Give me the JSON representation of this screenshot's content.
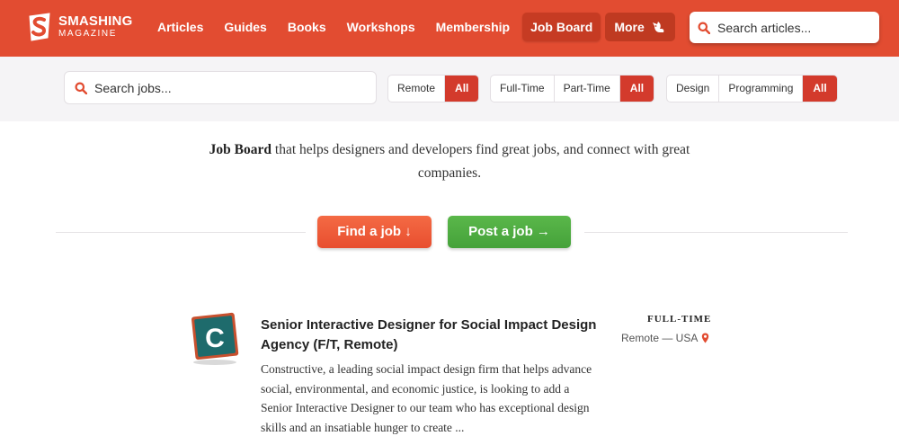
{
  "header": {
    "logo_line1": "SMASHING",
    "logo_line2": "MAGAZINE",
    "nav": [
      "Articles",
      "Guides",
      "Books",
      "Workshops",
      "Membership",
      "Job Board"
    ],
    "more_label": "More",
    "search_placeholder": "Search articles..."
  },
  "filters": {
    "search_placeholder": "Search jobs...",
    "location": [
      "Remote",
      "All"
    ],
    "employment": [
      "Full-Time",
      "Part-Time",
      "All"
    ],
    "category": [
      "Design",
      "Programming",
      "All"
    ]
  },
  "intro": {
    "bold": "Job Board",
    "text": " that helps designers and developers find great jobs, and connect with great companies."
  },
  "actions": {
    "find": "Find a job ↓",
    "post": "Post a job →"
  },
  "job": {
    "logo_letter": "C",
    "title": "Senior Interactive Designer for Social Impact Design Agency (F/T, Remote)",
    "description": "Constructive, a leading social impact design firm that helps advance social, environmental, and economic justice, is looking to add a Senior Interactive Designer to our team who has exceptional design skills and an insatiable hunger to create ...",
    "type": "FULL-TIME",
    "location": "Remote — USA"
  },
  "colors": {
    "brand": "#e24c31",
    "active": "#d33a2c",
    "find": "#ef5d3b",
    "post": "#4faf42",
    "logo_bg": "#1e6b6c"
  },
  "icons": [
    "smashing-logo-icon",
    "search-icon",
    "cat-icon",
    "location-pin-icon"
  ]
}
